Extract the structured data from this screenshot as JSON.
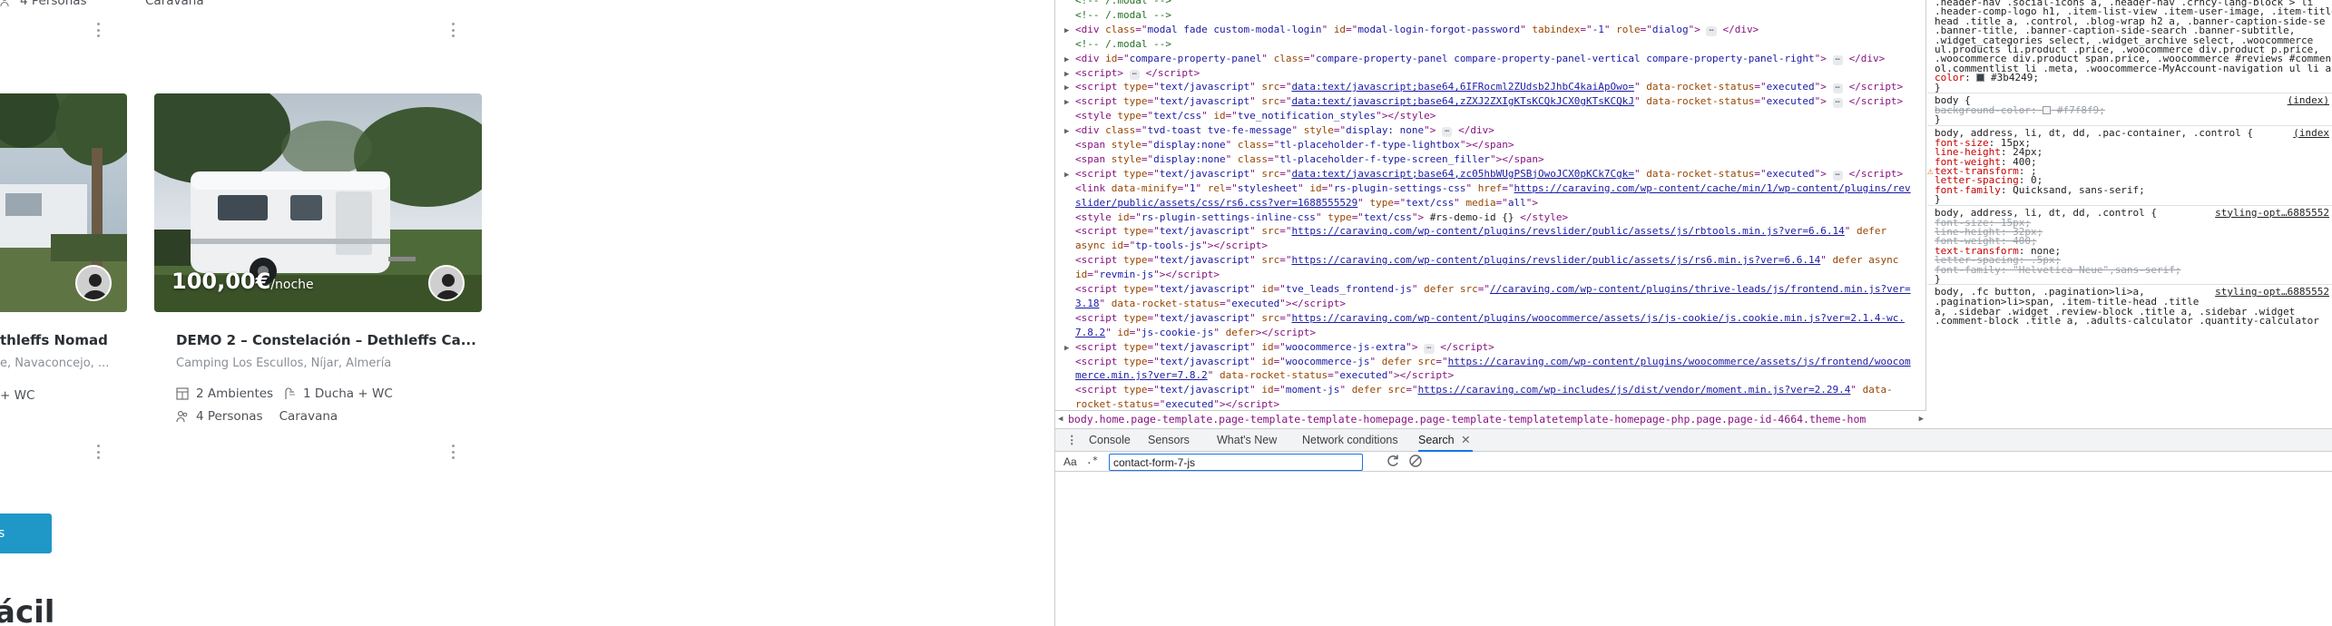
{
  "site": {
    "cards": [
      {
        "title": "thleffs Nomad",
        "location": "e, Navaconcejo, ...",
        "features_row1": "+ WC",
        "features_row2": ""
      },
      {
        "price": "100,00€",
        "price_unit": "/noche",
        "title": "DEMO 2 – Constelación – Dethleffs Ca...",
        "location": "Camping Los Escullos, Níjar, Almería",
        "ambientes": "2 Ambientes",
        "bano": "1 Ducha + WC",
        "personas": "4 Personas",
        "tipo": "Caravana"
      }
    ],
    "top_row": {
      "personas": "4 Personas",
      "tipo": "Caravana"
    },
    "heading_fragment": "ácil",
    "button_fragment": "s"
  },
  "devtools": {
    "dom_lines": [
      {
        "indent": 1,
        "arrow": "",
        "html": "<span class='cmt'>&lt;!-- /.modal --&gt;</span>"
      },
      {
        "indent": 1,
        "arrow": "",
        "html": "<span class='cmt'>&lt;!-- /.modal --&gt;</span>"
      },
      {
        "indent": 1,
        "arrow": "▶",
        "html": "<span class='tag'>&lt;div</span> <span class='attr'>class</span>=\"<span class='val'>modal fade custom-modal-login</span>\" <span class='attr'>id</span>=\"<span class='val'>modal-login-forgot-password</span>\" <span class='attr'>tabindex</span>=\"<span class='val'>-1</span>\" <span class='attr'>role</span>=\"<span class='val'>dialog</span>\"<span class='tag'>&gt;</span> <span class='ell'>⋯</span> <span class='tag'>&lt;/div&gt;</span>"
      },
      {
        "indent": 1,
        "arrow": "",
        "html": "<span class='cmt'>&lt;!-- /.modal --&gt;</span>"
      },
      {
        "indent": 1,
        "arrow": "▶",
        "html": "<span class='tag'>&lt;div</span> <span class='attr'>id</span>=\"<span class='val'>compare-property-panel</span>\" <span class='attr'>class</span>=\"<span class='val'>compare-property-panel compare-property-panel-vertical compare-property-panel-right</span>\"<span class='tag'>&gt;</span> <span class='ell'>⋯</span> <span class='tag'>&lt;/div&gt;</span>"
      },
      {
        "indent": 1,
        "arrow": "▶",
        "html": "<span class='tag'>&lt;script&gt;</span> <span class='ell'>⋯</span> <span class='tag'>&lt;/script&gt;</span>"
      },
      {
        "indent": 1,
        "arrow": "▶",
        "html": "<span class='tag'>&lt;script</span> <span class='attr'>type</span>=\"<span class='val'>text/javascript</span>\" <span class='attr'>src</span>=\"<span class='link'>data:text/javascript;base64,6IFRocml2ZUdsb2JhbC4kaiApOwo=</span>\" <span class='attr'>data-rocket-status</span>=\"<span class='val'>executed</span>\"<span class='tag'>&gt;</span> <span class='ell'>⋯</span> <span class='tag'>&lt;/script&gt;</span>"
      },
      {
        "indent": 1,
        "arrow": "▶",
        "html": "<span class='tag'>&lt;script</span> <span class='attr'>type</span>=\"<span class='val'>text/javascript</span>\" <span class='attr'>src</span>=\"<span class='link'>data:text/javascript;base64,zZXJ2ZXIgKTsKCQkJCX0gKTsKCQkJ</span>\" <span class='attr'>data-rocket-status</span>=\"<span class='val'>executed</span>\"<span class='tag'>&gt;</span> <span class='ell'>⋯</span> <span class='tag'>&lt;/script&gt;</span>"
      },
      {
        "indent": 1,
        "arrow": "",
        "html": "<span class='tag'>&lt;style</span> <span class='attr'>type</span>=\"<span class='val'>text/css</span>\" <span class='attr'>id</span>=\"<span class='val'>tve_notification_styles</span>\"<span class='tag'>&gt;&lt;/style&gt;</span>"
      },
      {
        "indent": 1,
        "arrow": "▶",
        "html": "<span class='tag'>&lt;div</span> <span class='attr'>class</span>=\"<span class='val'>tvd-toast tve-fe-message</span>\" <span class='attr'>style</span>=\"<span class='val'>display: none</span>\"<span class='tag'>&gt;</span> <span class='ell'>⋯</span> <span class='tag'>&lt;/div&gt;</span>"
      },
      {
        "indent": 1,
        "arrow": "",
        "html": "<span class='tag'>&lt;span</span> <span class='attr'>style</span>=\"<span class='val'>display:none</span>\" <span class='attr'>class</span>=\"<span class='val'>tl-placeholder-f-type-lightbox</span>\"<span class='tag'>&gt;&lt;/span&gt;</span>"
      },
      {
        "indent": 1,
        "arrow": "",
        "html": "<span class='tag'>&lt;span</span> <span class='attr'>style</span>=\"<span class='val'>display:none</span>\" <span class='attr'>class</span>=\"<span class='val'>tl-placeholder-f-type-screen_filler</span>\"<span class='tag'>&gt;&lt;/span&gt;</span>"
      },
      {
        "indent": 1,
        "arrow": "▶",
        "html": "<span class='tag'>&lt;script</span> <span class='attr'>type</span>=\"<span class='val'>text/javascript</span>\" <span class='attr'>src</span>=\"<span class='link'>data:text/javascript;base64,zc05hbWUgPSBjOwoJCX0pKCk7Cgk=</span>\" <span class='attr'>data-rocket-status</span>=\"<span class='val'>executed</span>\"<span class='tag'>&gt;</span> <span class='ell'>⋯</span> <span class='tag'>&lt;/script&gt;</span>"
      },
      {
        "indent": 1,
        "arrow": "",
        "html": "<span class='tag'>&lt;link</span> <span class='attr'>data-minify</span>=\"<span class='val'>1</span>\" <span class='attr'>rel</span>=\"<span class='val'>stylesheet</span>\" <span class='attr'>id</span>=\"<span class='val'>rs-plugin-settings-css</span>\" <span class='attr'>href</span>=\"<span class='link'>https://caraving.com/wp-content/cache/min/1/wp-content/plugins/rev</span>"
      },
      {
        "indent": 1,
        "arrow": "",
        "html": "<span class='link'>slider/public/assets/css/rs6.css?ver=1688555529</span>\" <span class='attr'>type</span>=\"<span class='val'>text/css</span>\" <span class='attr'>media</span>=\"<span class='val'>all</span>\"<span class='tag'>&gt;</span>"
      },
      {
        "indent": 1,
        "arrow": "",
        "html": "<span class='tag'>&lt;style</span> <span class='attr'>id</span>=\"<span class='val'>rs-plugin-settings-inline-css</span>\" <span class='attr'>type</span>=\"<span class='val'>text/css</span>\"<span class='tag'>&gt;</span><span class='txt'> #rs-demo-id {} </span><span class='tag'>&lt;/style&gt;</span>"
      },
      {
        "indent": 1,
        "arrow": "",
        "html": "<span class='tag'>&lt;script</span> <span class='attr'>type</span>=\"<span class='val'>text/javascript</span>\" <span class='attr'>src</span>=\"<span class='link'>https://caraving.com/wp-content/plugins/revslider/public/assets/js/rbtools.min.js?ver=6.6.14</span>\" <span class='attr'>defer</span>"
      },
      {
        "indent": 1,
        "arrow": "",
        "html": "<span class='attr'>async</span> <span class='attr'>id</span>=\"<span class='val'>tp-tools-js</span>\"<span class='tag'>&gt;&lt;/script&gt;</span>"
      },
      {
        "indent": 1,
        "arrow": "",
        "html": "<span class='tag'>&lt;script</span> <span class='attr'>type</span>=\"<span class='val'>text/javascript</span>\" <span class='attr'>src</span>=\"<span class='link'>https://caraving.com/wp-content/plugins/revslider/public/assets/js/rs6.min.js?ver=6.6.14</span>\" <span class='attr'>defer</span> <span class='attr'>async</span>"
      },
      {
        "indent": 1,
        "arrow": "",
        "html": "<span class='attr'>id</span>=\"<span class='val'>revmin-js</span>\"<span class='tag'>&gt;&lt;/script&gt;</span>"
      },
      {
        "indent": 1,
        "arrow": "",
        "html": "<span class='tag'>&lt;script</span> <span class='attr'>type</span>=\"<span class='val'>text/javascript</span>\" <span class='attr'>id</span>=\"<span class='val'>tve_leads_frontend-js</span>\" <span class='attr'>defer</span> <span class='attr'>src</span>=\"<span class='link'>//caraving.com/wp-content/plugins/thrive-leads/js/frontend.min.js?ver=</span>"
      },
      {
        "indent": 1,
        "arrow": "",
        "html": "<span class='link'>3.18</span>\" <span class='attr'>data-rocket-status</span>=\"<span class='val'>executed</span>\"<span class='tag'>&gt;&lt;/script&gt;</span>"
      },
      {
        "indent": 1,
        "arrow": "",
        "html": "<span class='tag'>&lt;script</span> <span class='attr'>type</span>=\"<span class='val'>text/javascript</span>\" <span class='attr'>src</span>=\"<span class='link'>https://caraving.com/wp-content/plugins/woocommerce/assets/js/js-cookie/js.cookie.min.js?ver=2.1.4-wc.</span>"
      },
      {
        "indent": 1,
        "arrow": "",
        "html": "<span class='link'>7.8.2</span>\" <span class='attr'>id</span>=\"<span class='val'>js-cookie-js</span>\" <span class='attr'>defer</span><span class='tag'>&gt;&lt;/script&gt;</span>"
      },
      {
        "indent": 1,
        "arrow": "▶",
        "html": "<span class='tag'>&lt;script</span> <span class='attr'>type</span>=\"<span class='val'>text/javascript</span>\" <span class='attr'>id</span>=\"<span class='val'>woocommerce-js-extra</span>\"<span class='tag'>&gt;</span> <span class='ell'>⋯</span> <span class='tag'>&lt;/script&gt;</span>"
      },
      {
        "indent": 1,
        "arrow": "",
        "html": "<span class='tag'>&lt;script</span> <span class='attr'>type</span>=\"<span class='val'>text/javascript</span>\" <span class='attr'>id</span>=\"<span class='val'>woocommerce-js</span>\" <span class='attr'>defer</span> <span class='attr'>src</span>=\"<span class='link'>https://caraving.com/wp-content/plugins/woocommerce/assets/js/frontend/woocom</span>"
      },
      {
        "indent": 1,
        "arrow": "",
        "html": "<span class='link'>merce.min.js?ver=7.8.2</span>\" <span class='attr'>data-rocket-status</span>=\"<span class='val'>executed</span>\"<span class='tag'>&gt;&lt;/script&gt;</span>"
      },
      {
        "indent": 1,
        "arrow": "",
        "html": "<span class='tag'>&lt;script</span> <span class='attr'>type</span>=\"<span class='val'>text/javascript</span>\" <span class='attr'>id</span>=\"<span class='val'>moment-js</span>\" <span class='attr'>defer</span> <span class='attr'>src</span>=\"<span class='link'>https://caraving.com/wp-includes/js/dist/vendor/moment.min.js?ver=2.29.4</span>\" <span class='attr'>data-</span>"
      },
      {
        "indent": 1,
        "arrow": "",
        "html": "<span class='attr'>rocket-status</span>=\"<span class='val'>executed</span>\"<span class='tag'>&gt;&lt;/script&gt;</span>"
      }
    ],
    "breadcrumb": "body.home.page-template.page-template-template-homepage.page-template-templatetemplate-homepage-php.page.page-id-4664.theme-hom",
    "styles": [
      {
        "kind": "text",
        "html": ".header-nav .social-icons a, .header-nav .crncy-lang-block > li"
      },
      {
        "kind": "text",
        "html": ".header-comp-logo h1, .item-list-view .item-user-image, .item-title"
      },
      {
        "kind": "text",
        "html": "head .title a, .control, .blog-wrap h2 a, .banner-caption-side-se"
      },
      {
        "kind": "text",
        "html": ".banner-title, .banner-caption-side-search .banner-subtitle,"
      },
      {
        "kind": "text",
        "html": ".widget_categories select, .widget_archive select, .woocommerce"
      },
      {
        "kind": "text",
        "html": "ul.products li.product .price, .woocommerce div.product p.price,"
      },
      {
        "kind": "text",
        "html": ".woocommerce div.product span.price, .woocommerce #reviews #comments"
      },
      {
        "kind": "text",
        "html": "ol.commentlist li .meta, .woocommerce-MyAccount-navigation ul li a"
      },
      {
        "kind": "prop",
        "html": "  <span class='prop'>color</span>: <span style='display:inline-block;width:9px;height:9px;background:#3b4249;border:1px solid #999;vertical-align:-1px'></span> #3b4249;"
      },
      {
        "kind": "text",
        "html": "}"
      },
      {
        "kind": "rule",
        "html": "body {",
        "src": "(index)"
      },
      {
        "kind": "strike",
        "html": "  <span class='prop'>background-color</span>: <span style='display:inline-block;width:9px;height:9px;background:#f7f8f9;border:1px solid #999;vertical-align:-1px'></span> #f7f8f9;"
      },
      {
        "kind": "text",
        "html": "}"
      },
      {
        "kind": "rule",
        "html": "body, address, li, dt, dd, .pac-container, .control {",
        "src": "(index"
      },
      {
        "kind": "prop",
        "html": "  <span class='prop'>font-size</span>: 15px;"
      },
      {
        "kind": "prop",
        "html": "  <span class='prop'>line-height</span>: 24px;"
      },
      {
        "kind": "prop",
        "html": "  <span class='prop'>font-weight</span>: 400;"
      },
      {
        "kind": "warn",
        "html": "  <span class='prop'>text-transform</span>: ;"
      },
      {
        "kind": "prop",
        "html": "  <span class='prop'>letter-spacing</span>: 0;"
      },
      {
        "kind": "prop",
        "html": "  <span class='prop'>font-family</span>: Quicksand, sans-serif;"
      },
      {
        "kind": "text",
        "html": "}"
      },
      {
        "kind": "rule",
        "html": "body, address, li, dt, dd, .control {",
        "src": "styling-opt…6885552"
      },
      {
        "kind": "strike",
        "html": "  <span class='prop'>font-size</span>: 15px;"
      },
      {
        "kind": "strike",
        "html": "  <span class='prop'>line-height</span>: 32px;"
      },
      {
        "kind": "strike",
        "html": "  <span class='prop'>font-weight</span>: 400;"
      },
      {
        "kind": "prop",
        "html": "  <span class='prop'>text-transform</span>: none;"
      },
      {
        "kind": "strike",
        "html": "  <span class='prop'>letter-spacing</span>: .5px;"
      },
      {
        "kind": "strike",
        "html": "  <span class='prop'>font-family</span>: \"Helvetica Neue\",sans-serif;"
      },
      {
        "kind": "text",
        "html": "}"
      },
      {
        "kind": "rule",
        "html": "body, .fc button, .pagination>li>a,",
        "src": "styling-opt…6885552"
      },
      {
        "kind": "text",
        "html": ".pagination>li>span, .item-title-head .title"
      },
      {
        "kind": "text",
        "html": "a, .sidebar .widget .review-block .title a, .sidebar .widget"
      },
      {
        "kind": "text",
        "html": ".comment-block .title a, .adults-calculator .quantity-calculator"
      }
    ],
    "drawer_tabs": [
      "Console",
      "Sensors",
      "What's New",
      "Network conditions",
      "Search"
    ],
    "active_tab": "Search",
    "search": {
      "case_label": "Aa",
      "regex_label": ".*",
      "query": "contact-form-7-js"
    }
  }
}
